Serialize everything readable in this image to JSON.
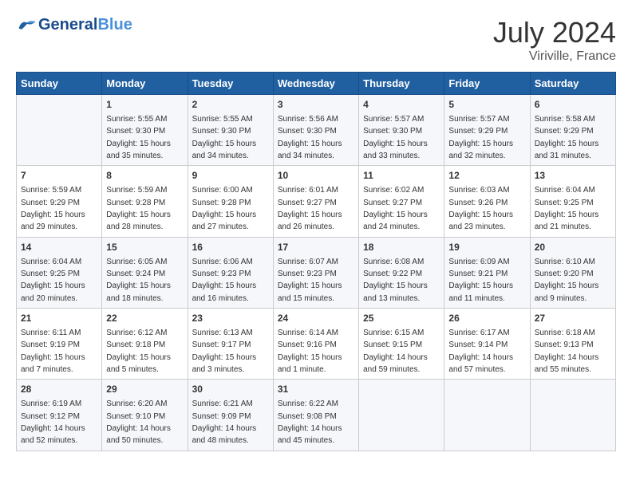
{
  "header": {
    "logo_general": "General",
    "logo_blue": "Blue",
    "month_year": "July 2024",
    "location": "Viriville, France"
  },
  "days_of_week": [
    "Sunday",
    "Monday",
    "Tuesday",
    "Wednesday",
    "Thursday",
    "Friday",
    "Saturday"
  ],
  "weeks": [
    [
      {
        "day": "",
        "info": ""
      },
      {
        "day": "1",
        "info": "Sunrise: 5:55 AM\nSunset: 9:30 PM\nDaylight: 15 hours\nand 35 minutes."
      },
      {
        "day": "2",
        "info": "Sunrise: 5:55 AM\nSunset: 9:30 PM\nDaylight: 15 hours\nand 34 minutes."
      },
      {
        "day": "3",
        "info": "Sunrise: 5:56 AM\nSunset: 9:30 PM\nDaylight: 15 hours\nand 34 minutes."
      },
      {
        "day": "4",
        "info": "Sunrise: 5:57 AM\nSunset: 9:30 PM\nDaylight: 15 hours\nand 33 minutes."
      },
      {
        "day": "5",
        "info": "Sunrise: 5:57 AM\nSunset: 9:29 PM\nDaylight: 15 hours\nand 32 minutes."
      },
      {
        "day": "6",
        "info": "Sunrise: 5:58 AM\nSunset: 9:29 PM\nDaylight: 15 hours\nand 31 minutes."
      }
    ],
    [
      {
        "day": "7",
        "info": "Sunrise: 5:59 AM\nSunset: 9:29 PM\nDaylight: 15 hours\nand 29 minutes."
      },
      {
        "day": "8",
        "info": "Sunrise: 5:59 AM\nSunset: 9:28 PM\nDaylight: 15 hours\nand 28 minutes."
      },
      {
        "day": "9",
        "info": "Sunrise: 6:00 AM\nSunset: 9:28 PM\nDaylight: 15 hours\nand 27 minutes."
      },
      {
        "day": "10",
        "info": "Sunrise: 6:01 AM\nSunset: 9:27 PM\nDaylight: 15 hours\nand 26 minutes."
      },
      {
        "day": "11",
        "info": "Sunrise: 6:02 AM\nSunset: 9:27 PM\nDaylight: 15 hours\nand 24 minutes."
      },
      {
        "day": "12",
        "info": "Sunrise: 6:03 AM\nSunset: 9:26 PM\nDaylight: 15 hours\nand 23 minutes."
      },
      {
        "day": "13",
        "info": "Sunrise: 6:04 AM\nSunset: 9:25 PM\nDaylight: 15 hours\nand 21 minutes."
      }
    ],
    [
      {
        "day": "14",
        "info": "Sunrise: 6:04 AM\nSunset: 9:25 PM\nDaylight: 15 hours\nand 20 minutes."
      },
      {
        "day": "15",
        "info": "Sunrise: 6:05 AM\nSunset: 9:24 PM\nDaylight: 15 hours\nand 18 minutes."
      },
      {
        "day": "16",
        "info": "Sunrise: 6:06 AM\nSunset: 9:23 PM\nDaylight: 15 hours\nand 16 minutes."
      },
      {
        "day": "17",
        "info": "Sunrise: 6:07 AM\nSunset: 9:23 PM\nDaylight: 15 hours\nand 15 minutes."
      },
      {
        "day": "18",
        "info": "Sunrise: 6:08 AM\nSunset: 9:22 PM\nDaylight: 15 hours\nand 13 minutes."
      },
      {
        "day": "19",
        "info": "Sunrise: 6:09 AM\nSunset: 9:21 PM\nDaylight: 15 hours\nand 11 minutes."
      },
      {
        "day": "20",
        "info": "Sunrise: 6:10 AM\nSunset: 9:20 PM\nDaylight: 15 hours\nand 9 minutes."
      }
    ],
    [
      {
        "day": "21",
        "info": "Sunrise: 6:11 AM\nSunset: 9:19 PM\nDaylight: 15 hours\nand 7 minutes."
      },
      {
        "day": "22",
        "info": "Sunrise: 6:12 AM\nSunset: 9:18 PM\nDaylight: 15 hours\nand 5 minutes."
      },
      {
        "day": "23",
        "info": "Sunrise: 6:13 AM\nSunset: 9:17 PM\nDaylight: 15 hours\nand 3 minutes."
      },
      {
        "day": "24",
        "info": "Sunrise: 6:14 AM\nSunset: 9:16 PM\nDaylight: 15 hours\nand 1 minute."
      },
      {
        "day": "25",
        "info": "Sunrise: 6:15 AM\nSunset: 9:15 PM\nDaylight: 14 hours\nand 59 minutes."
      },
      {
        "day": "26",
        "info": "Sunrise: 6:17 AM\nSunset: 9:14 PM\nDaylight: 14 hours\nand 57 minutes."
      },
      {
        "day": "27",
        "info": "Sunrise: 6:18 AM\nSunset: 9:13 PM\nDaylight: 14 hours\nand 55 minutes."
      }
    ],
    [
      {
        "day": "28",
        "info": "Sunrise: 6:19 AM\nSunset: 9:12 PM\nDaylight: 14 hours\nand 52 minutes."
      },
      {
        "day": "29",
        "info": "Sunrise: 6:20 AM\nSunset: 9:10 PM\nDaylight: 14 hours\nand 50 minutes."
      },
      {
        "day": "30",
        "info": "Sunrise: 6:21 AM\nSunset: 9:09 PM\nDaylight: 14 hours\nand 48 minutes."
      },
      {
        "day": "31",
        "info": "Sunrise: 6:22 AM\nSunset: 9:08 PM\nDaylight: 14 hours\nand 45 minutes."
      },
      {
        "day": "",
        "info": ""
      },
      {
        "day": "",
        "info": ""
      },
      {
        "day": "",
        "info": ""
      }
    ]
  ]
}
